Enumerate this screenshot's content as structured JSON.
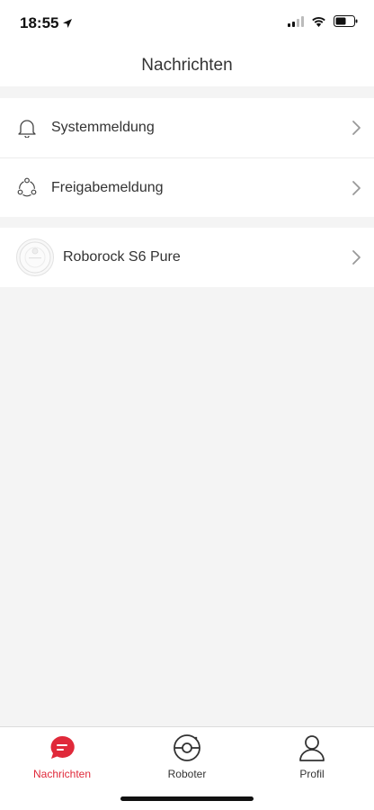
{
  "status_bar": {
    "time": "18:55",
    "location_icon": "location-arrow-icon",
    "signal_icon": "cellular-signal-icon",
    "wifi_icon": "wifi-icon",
    "battery_icon": "battery-icon"
  },
  "header": {
    "title": "Nachrichten"
  },
  "list_sections": [
    {
      "items": [
        {
          "icon": "bell-icon",
          "label": "Systemmeldung"
        },
        {
          "icon": "share-icon",
          "label": "Freigabemeldung"
        }
      ]
    },
    {
      "items": [
        {
          "icon": "robot-vacuum-avatar",
          "label": "Roborock S6 Pure"
        }
      ]
    }
  ],
  "tab_bar": {
    "tabs": [
      {
        "label": "Nachrichten",
        "icon": "chat-bubble-icon",
        "active": true
      },
      {
        "label": "Roboter",
        "icon": "robot-vacuum-icon",
        "active": false
      },
      {
        "label": "Profil",
        "icon": "person-icon",
        "active": false
      }
    ]
  },
  "colors": {
    "accent": "#e0293a",
    "background": "#f4f4f4",
    "surface": "#ffffff",
    "text": "#333333"
  }
}
